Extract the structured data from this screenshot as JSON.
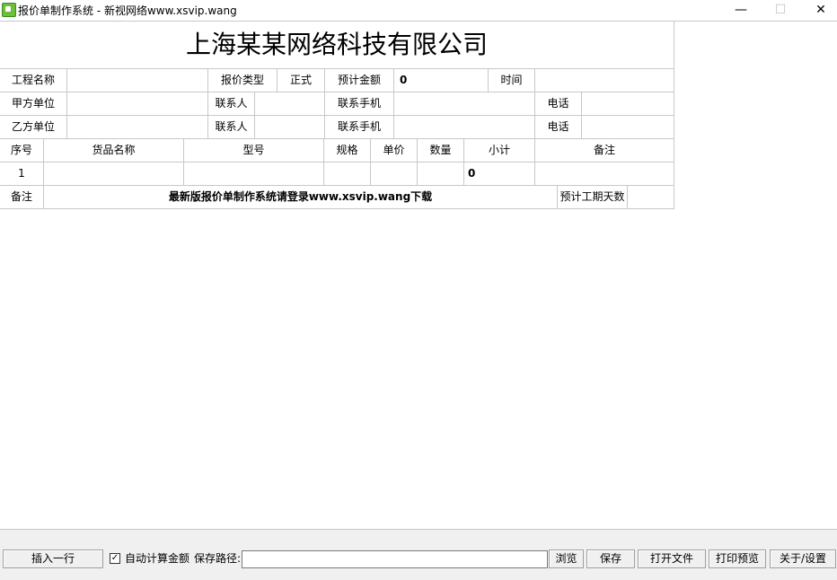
{
  "window": {
    "title": "报价单制作系统  -  新视网络www.xsvip.wang",
    "minimize": "—",
    "maximize": "☐",
    "close": "✕"
  },
  "form": {
    "company_name": "上海某某网络科技有限公司",
    "row_project": {
      "project_name_label": "工程名称",
      "project_name_value": "",
      "quote_type_label": "报价类型",
      "quote_type_value": "正式",
      "estimated_amount_label": "预计金额",
      "estimated_amount_value": "0",
      "time_label": "时间",
      "time_value": ""
    },
    "row_party_a": {
      "unit_label": "甲方单位",
      "unit_value": "",
      "contact_label": "联系人",
      "contact_value": "",
      "mobile_label": "联系手机",
      "mobile_value": "",
      "phone_label": "电话",
      "phone_value": ""
    },
    "row_party_b": {
      "unit_label": "乙方单位",
      "unit_value": "",
      "contact_label": "联系人",
      "contact_value": "",
      "mobile_label": "联系手机",
      "mobile_value": "",
      "phone_label": "电话",
      "phone_value": ""
    },
    "items_header": [
      "序号",
      "货品名称",
      "型号",
      "规格",
      "单价",
      "数量",
      "小计",
      "备注"
    ],
    "items": [
      {
        "no": "1",
        "name": "",
        "model": "",
        "spec": "",
        "unit_price": "",
        "quantity": "",
        "subtotal": "0",
        "remark": ""
      }
    ],
    "footer": {
      "remark_label": "备注",
      "remark_text": "最新版报价单制作系统请登录www.xsvip.wang下载",
      "duration_label": "预计工期天数",
      "duration_value": ""
    }
  },
  "toolbar": {
    "insert_row": "插入一行",
    "auto_calc_checked": true,
    "auto_calc_check_mark": "✓",
    "auto_calc_label": "自动计算金额",
    "save_path_label": "保存路径:",
    "save_path_value": "",
    "browse": "浏览",
    "save": "保存",
    "open_file": "打开文件",
    "print_preview": "打印预览",
    "about_settings": "关于/设置"
  }
}
